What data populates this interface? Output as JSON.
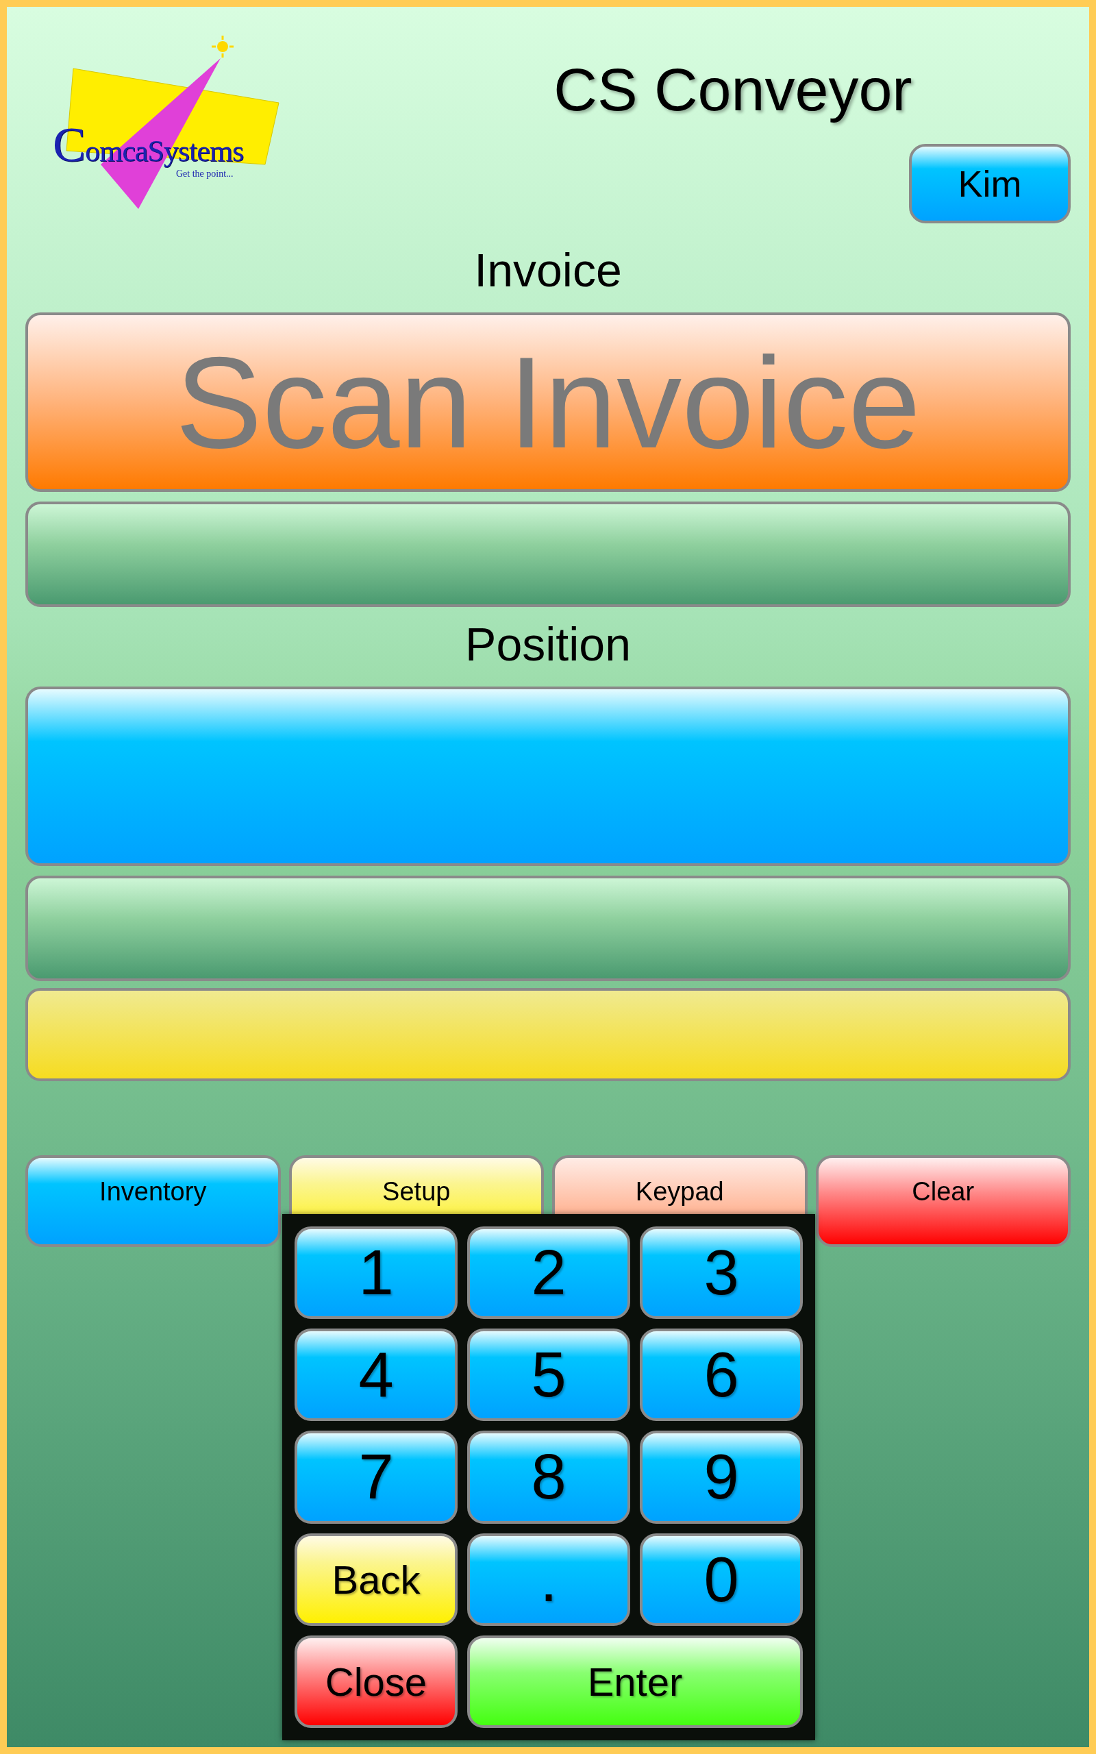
{
  "logo": {
    "wordmark": "ComcaSystems",
    "tagline": "Get the point..."
  },
  "title": "CS Conveyor",
  "user_button": "Kim",
  "invoice": {
    "label": "Invoice",
    "placeholder": "Scan Invoice"
  },
  "position": {
    "label": "Position"
  },
  "actions": [
    {
      "label": "Inventory",
      "kind": "blue"
    },
    {
      "label": "Setup",
      "kind": "yellow"
    },
    {
      "label": "Keypad",
      "kind": "peach"
    },
    {
      "label": "Clear",
      "kind": "red"
    }
  ],
  "keypad": [
    {
      "label": "1",
      "kind": "digit"
    },
    {
      "label": "2",
      "kind": "digit"
    },
    {
      "label": "3",
      "kind": "digit"
    },
    {
      "label": "4",
      "kind": "digit"
    },
    {
      "label": "5",
      "kind": "digit"
    },
    {
      "label": "6",
      "kind": "digit"
    },
    {
      "label": "7",
      "kind": "digit"
    },
    {
      "label": "8",
      "kind": "digit"
    },
    {
      "label": "9",
      "kind": "digit"
    },
    {
      "label": "Back",
      "kind": "back"
    },
    {
      "label": ".",
      "kind": "digit"
    },
    {
      "label": "0",
      "kind": "digit"
    },
    {
      "label": "Close",
      "kind": "close"
    },
    {
      "label": "Enter",
      "kind": "enter"
    }
  ]
}
